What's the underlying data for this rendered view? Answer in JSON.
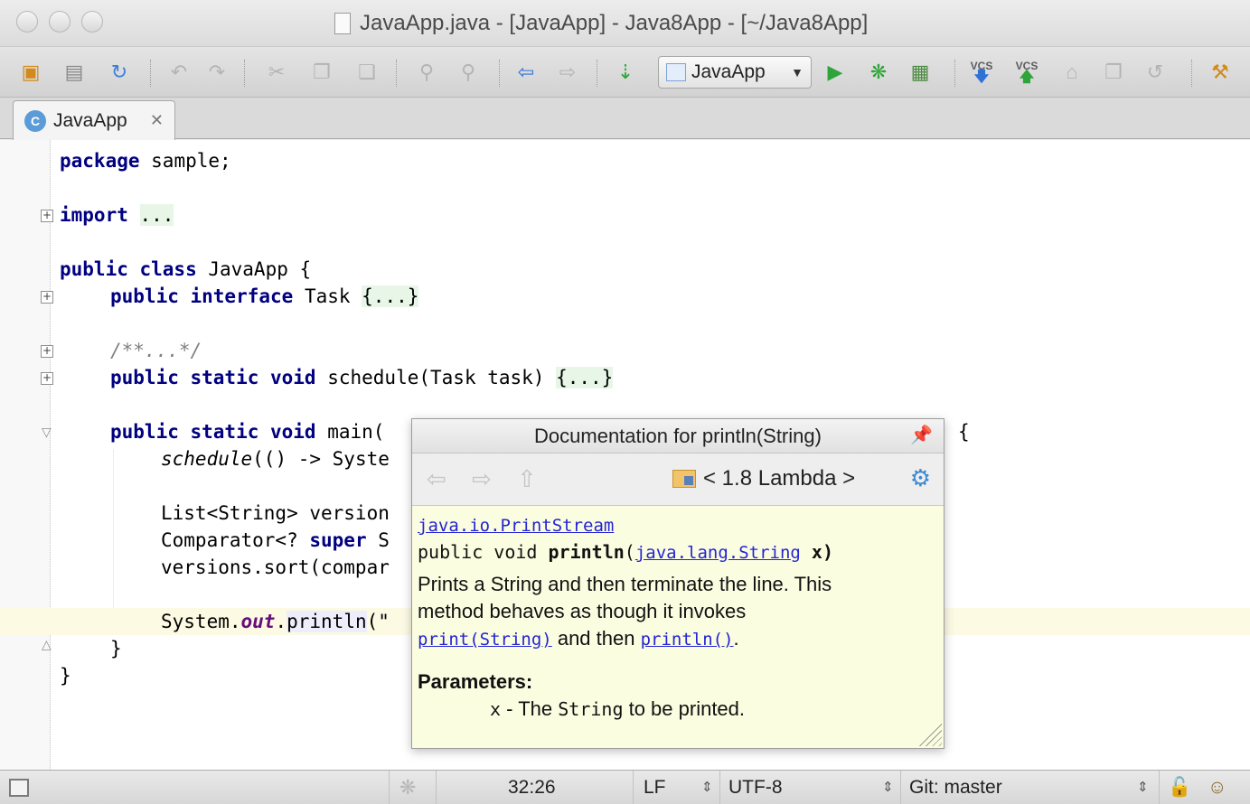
{
  "window": {
    "title": "JavaApp.java - [JavaApp] - Java8App - [~/Java8App]"
  },
  "toolbar": {
    "run_config": "JavaApp",
    "vcs_update_label": "VCS",
    "vcs_commit_label": "VCS",
    "icons": [
      "folder-icon",
      "save-icon",
      "sync-icon",
      "undo-icon",
      "redo-icon",
      "cut-icon",
      "copy-icon",
      "paste-icon",
      "find-icon",
      "replace-icon",
      "back-icon",
      "forward-icon",
      "sort-icon",
      "run-icon",
      "debug-icon",
      "coverage-icon",
      "vcs-update-icon",
      "vcs-commit-icon",
      "vcs-history-icon",
      "vcs-compare-icon",
      "revert-icon",
      "settings-icon"
    ]
  },
  "tabs": [
    {
      "label": "JavaApp",
      "icon": "java-class-icon"
    }
  ],
  "editor": {
    "lines": {
      "l1_kw": "package",
      "l1_rest": " sample;",
      "l2_kw": "import",
      "l2_fold": "...",
      "l3_kw": "public class",
      "l3_rest": " JavaApp {",
      "l4_kw": "public interface",
      "l4_rest": " Task ",
      "l4_fold": "{...}",
      "l5_comment": "/**...*/",
      "l6_kw": "public static void",
      "l6_rest": " schedule(Task task) ",
      "l6_fold": "{...}",
      "l7_kw": "public static void",
      "l7_rest": " main(",
      "l7_tail": "{",
      "l8_it": "schedule",
      "l8_rest": "(() -> Syste",
      "l9": "List<String> version",
      "l10_a": "Comparator<? ",
      "l10_kw": "super",
      "l10_b": " S",
      "l11": "versions.sort(compar",
      "l12_a": "System.",
      "l12_out": "out",
      "l12_b": ".",
      "l12_call": "println",
      "l12_c": "(\"",
      "l13": "}",
      "l14": "}"
    }
  },
  "doc_popup": {
    "title": "Documentation for println(String)",
    "context": "< 1.8 Lambda >",
    "class_link": "java.io.PrintStream",
    "sig_a": "public void ",
    "sig_method": "println",
    "sig_b": "(",
    "sig_type_link": "java.lang.String",
    "sig_c": " x)",
    "desc_1": "Prints a String and then terminate the line. This",
    "desc_2": "method behaves as though it invokes",
    "link_print": "print(String)",
    "desc_3": " and then ",
    "link_println": "println()",
    "desc_4": ".",
    "params_label": "Parameters:",
    "param_name": "x",
    "param_dash": " - The ",
    "param_type": "String",
    "param_rest": " to be printed."
  },
  "statusbar": {
    "position": "32:26",
    "line_separator": "LF",
    "encoding": "UTF-8",
    "vcs_branch": "Git: master"
  }
}
